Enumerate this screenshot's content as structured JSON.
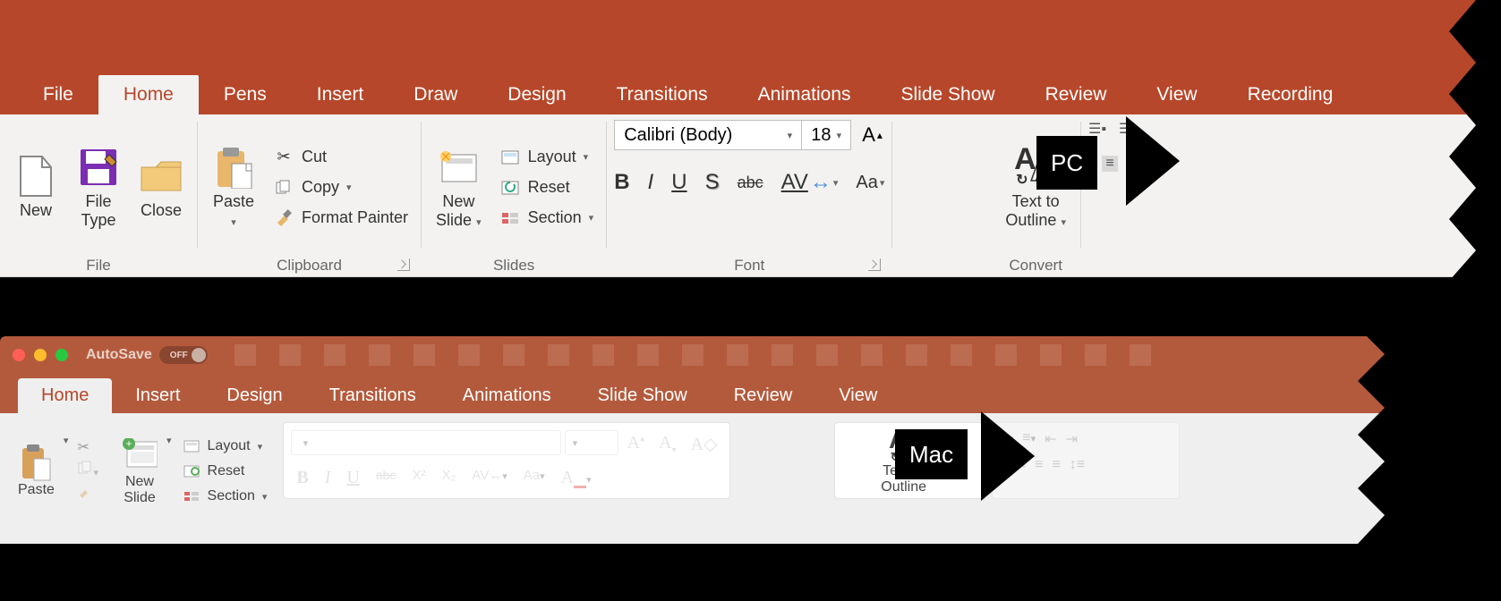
{
  "pc": {
    "tabs": [
      "File",
      "Home",
      "Pens",
      "Insert",
      "Draw",
      "Design",
      "Transitions",
      "Animations",
      "Slide Show",
      "Review",
      "View",
      "Recording"
    ],
    "active_tab": "Home",
    "file_group": {
      "label": "File",
      "new": "New",
      "filetype": "File\nType",
      "close": "Close"
    },
    "clipboard": {
      "label": "Clipboard",
      "paste": "Paste",
      "cut": "Cut",
      "copy": "Copy",
      "painter": "Format Painter"
    },
    "slides": {
      "label": "Slides",
      "newslide": "New\nSlide",
      "layout": "Layout",
      "reset": "Reset",
      "section": "Section"
    },
    "font": {
      "label": "Font",
      "name": "Calibri (Body)",
      "size": "18",
      "bold": "B",
      "italic": "I",
      "underline": "U",
      "shadow": "S",
      "strike": "abc",
      "spacing": "AV",
      "case": "Aa"
    },
    "convert": {
      "label": "Convert",
      "t2o": "Text to\nOutline"
    },
    "callout": "PC"
  },
  "mac": {
    "autosave_label": "AutoSave",
    "autosave_state": "OFF",
    "tabs": [
      "Home",
      "Insert",
      "Design",
      "Transitions",
      "Animations",
      "Slide Show",
      "Review",
      "View"
    ],
    "active_tab": "Home",
    "paste": "Paste",
    "newslide": "New\nSlide",
    "layout": "Layout",
    "reset": "Reset",
    "section": "Section",
    "bold": "B",
    "italic": "I",
    "underline": "U",
    "strike": "abc",
    "sup": "X²",
    "sub": "X₂",
    "spacing": "AV",
    "case": "Aa",
    "t2o": "Text to\nOutline",
    "callout": "Mac"
  }
}
